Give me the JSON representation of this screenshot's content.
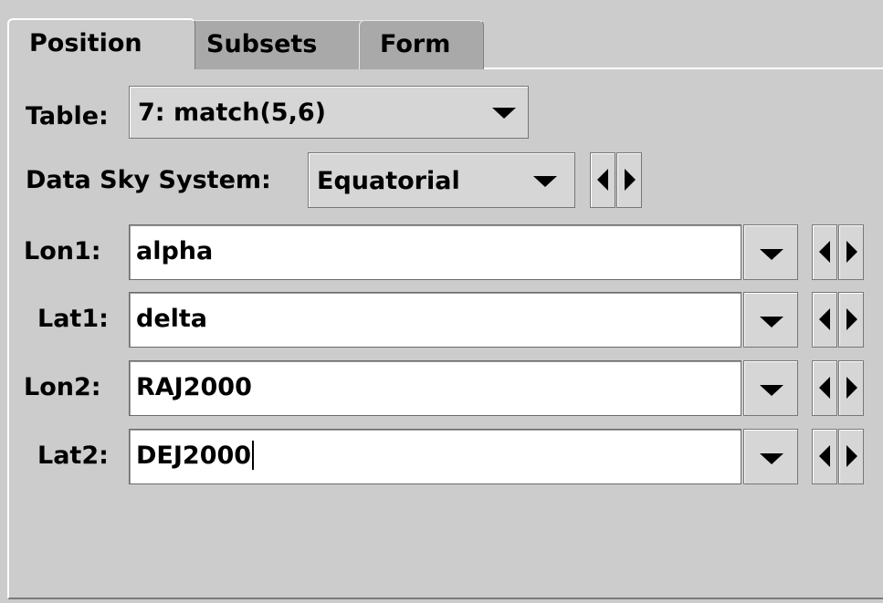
{
  "tabs": {
    "position": "Position",
    "subsets": "Subsets",
    "form": "Form"
  },
  "table": {
    "label": "Table:",
    "value": "7: match(5,6)"
  },
  "sky_system": {
    "label": "Data Sky System:",
    "value": "Equatorial"
  },
  "fields": {
    "lon1": {
      "label": "Lon1:",
      "value": "alpha"
    },
    "lat1": {
      "label": "Lat1:",
      "value": "delta"
    },
    "lon2": {
      "label": "Lon2:",
      "value": "RAJ2000"
    },
    "lat2": {
      "label": "Lat2:",
      "value": "DEJ2000"
    }
  },
  "icons": {
    "dropdown": "chevron-down-icon",
    "previous": "arrow-left-icon",
    "next": "arrow-right-icon"
  },
  "colors": {
    "panel_bg": "#cccccc",
    "tab_unselected_bg": "#a9a9a9",
    "field_bg": "#ffffff"
  }
}
